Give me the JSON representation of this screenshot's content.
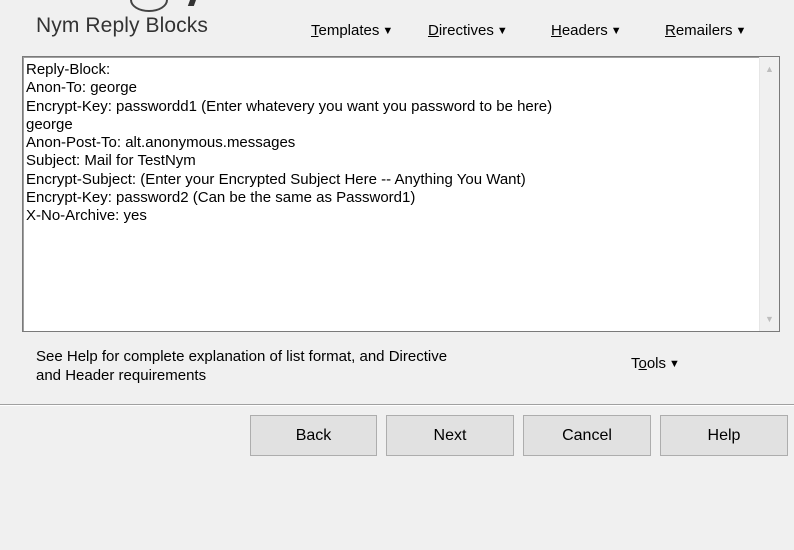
{
  "header": {
    "title": "Nym Reply Blocks",
    "menus": [
      {
        "accel": "T",
        "rest": "emplates"
      },
      {
        "accel": "D",
        "rest": "irectives"
      },
      {
        "accel": "H",
        "rest": "eaders"
      },
      {
        "accel": "R",
        "rest": "emailers"
      }
    ]
  },
  "editor": {
    "lines": [
      "Reply-Block:",
      "Anon-To: george",
      "Encrypt-Key: passwordd1 (Enter whatevery you want you password to be here)",
      "george",
      "Anon-Post-To: alt.anonymous.messages",
      "Subject: Mail for TestNym",
      "Encrypt-Subject: (Enter your Encrypted Subject Here -- Anything You Want)",
      "Encrypt-Key: password2 (Can be the same as Password1)",
      "X-No-Archive: yes"
    ]
  },
  "footer": {
    "help_text_line1": "See Help for complete explanation of list format, and Directive",
    "help_text_line2": "and Header requirements",
    "tools": {
      "pre": "T",
      "accel": "o",
      "rest": "ols"
    }
  },
  "buttons": {
    "back": "Back",
    "next": "Next",
    "cancel": "Cancel",
    "help": "Help"
  },
  "icons": {
    "menu_caret": "caret-down-icon",
    "scroll_up": "scroll-up-arrow-icon",
    "scroll_down": "scroll-down-arrow-icon"
  }
}
